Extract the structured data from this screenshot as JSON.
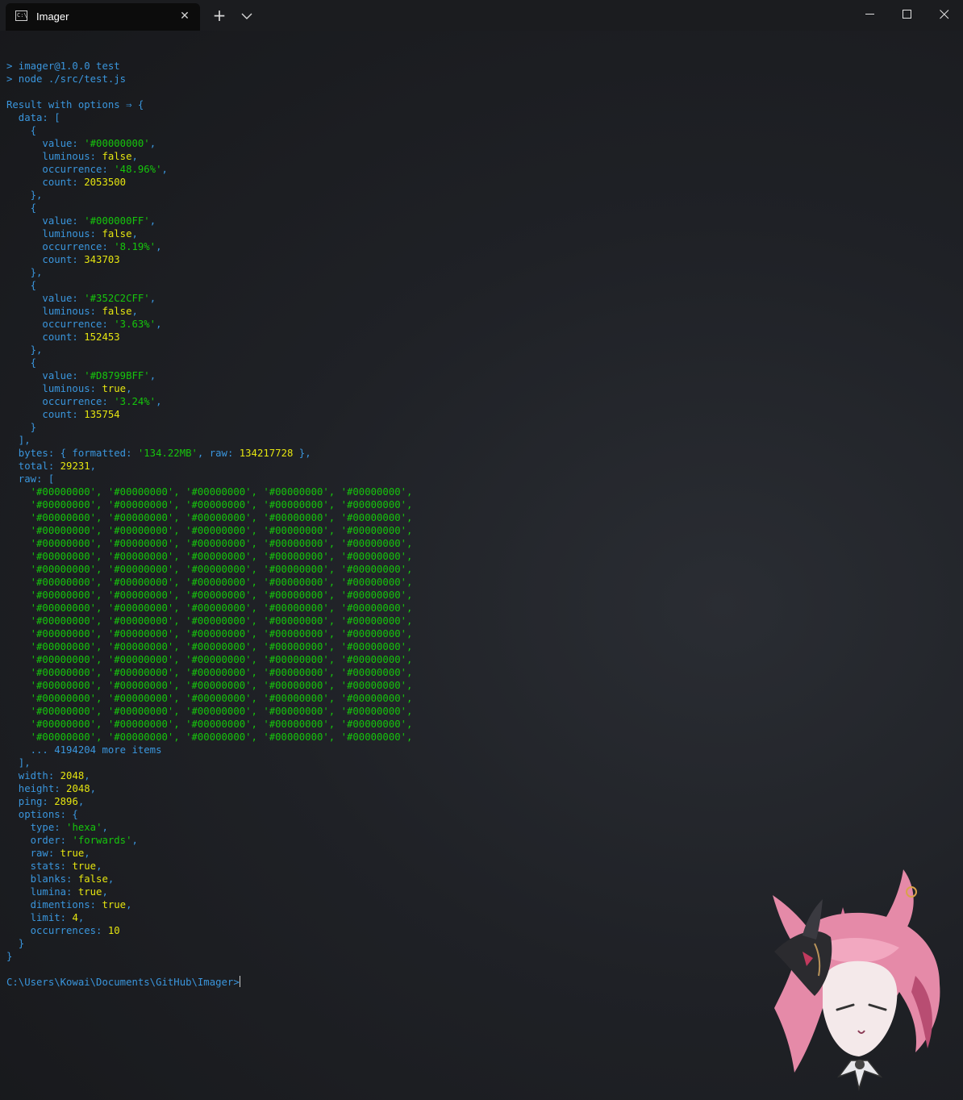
{
  "window": {
    "tab_title": "Imager",
    "tab_icon_text": "C:\\"
  },
  "terminal": {
    "lines": [
      [],
      [
        [
          "k",
          "> imager@1.0.0 test"
        ]
      ],
      [
        [
          "k",
          "> node ./src/test.js"
        ]
      ],
      [],
      [
        [
          "k",
          "Result with options ⇒ {"
        ]
      ],
      [
        [
          "k",
          "  data: ["
        ]
      ],
      [
        [
          "k",
          "    {"
        ]
      ],
      [
        [
          "k",
          "      value: "
        ],
        [
          "s",
          "'#00000000'"
        ],
        [
          "k",
          ","
        ]
      ],
      [
        [
          "k",
          "      luminous: "
        ],
        [
          "y",
          "false"
        ],
        [
          "k",
          ","
        ]
      ],
      [
        [
          "k",
          "      occurrence: "
        ],
        [
          "s",
          "'48.96%'"
        ],
        [
          "k",
          ","
        ]
      ],
      [
        [
          "k",
          "      count: "
        ],
        [
          "y",
          "2053500"
        ]
      ],
      [
        [
          "k",
          "    },"
        ]
      ],
      [
        [
          "k",
          "    {"
        ]
      ],
      [
        [
          "k",
          "      value: "
        ],
        [
          "s",
          "'#000000FF'"
        ],
        [
          "k",
          ","
        ]
      ],
      [
        [
          "k",
          "      luminous: "
        ],
        [
          "y",
          "false"
        ],
        [
          "k",
          ","
        ]
      ],
      [
        [
          "k",
          "      occurrence: "
        ],
        [
          "s",
          "'8.19%'"
        ],
        [
          "k",
          ","
        ]
      ],
      [
        [
          "k",
          "      count: "
        ],
        [
          "y",
          "343703"
        ]
      ],
      [
        [
          "k",
          "    },"
        ]
      ],
      [
        [
          "k",
          "    {"
        ]
      ],
      [
        [
          "k",
          "      value: "
        ],
        [
          "s",
          "'#352C2CFF'"
        ],
        [
          "k",
          ","
        ]
      ],
      [
        [
          "k",
          "      luminous: "
        ],
        [
          "y",
          "false"
        ],
        [
          "k",
          ","
        ]
      ],
      [
        [
          "k",
          "      occurrence: "
        ],
        [
          "s",
          "'3.63%'"
        ],
        [
          "k",
          ","
        ]
      ],
      [
        [
          "k",
          "      count: "
        ],
        [
          "y",
          "152453"
        ]
      ],
      [
        [
          "k",
          "    },"
        ]
      ],
      [
        [
          "k",
          "    {"
        ]
      ],
      [
        [
          "k",
          "      value: "
        ],
        [
          "s",
          "'#D8799BFF'"
        ],
        [
          "k",
          ","
        ]
      ],
      [
        [
          "k",
          "      luminous: "
        ],
        [
          "y",
          "true"
        ],
        [
          "k",
          ","
        ]
      ],
      [
        [
          "k",
          "      occurrence: "
        ],
        [
          "s",
          "'3.24%'"
        ],
        [
          "k",
          ","
        ]
      ],
      [
        [
          "k",
          "      count: "
        ],
        [
          "y",
          "135754"
        ]
      ],
      [
        [
          "k",
          "    }"
        ]
      ],
      [
        [
          "k",
          "  ],"
        ]
      ],
      [
        [
          "k",
          "  bytes: { formatted: "
        ],
        [
          "s",
          "'134.22MB'"
        ],
        [
          "k",
          ", raw: "
        ],
        [
          "y",
          "134217728"
        ],
        [
          "k",
          " },"
        ]
      ],
      [
        [
          "k",
          "  total: "
        ],
        [
          "y",
          "29231"
        ],
        [
          "k",
          ","
        ]
      ],
      [
        [
          "k",
          "  raw: ["
        ]
      ],
      [
        [
          "s",
          "    '#00000000', '#00000000', '#00000000', '#00000000', '#00000000',"
        ]
      ],
      [
        [
          "s",
          "    '#00000000', '#00000000', '#00000000', '#00000000', '#00000000',"
        ]
      ],
      [
        [
          "s",
          "    '#00000000', '#00000000', '#00000000', '#00000000', '#00000000',"
        ]
      ],
      [
        [
          "s",
          "    '#00000000', '#00000000', '#00000000', '#00000000', '#00000000',"
        ]
      ],
      [
        [
          "s",
          "    '#00000000', '#00000000', '#00000000', '#00000000', '#00000000',"
        ]
      ],
      [
        [
          "s",
          "    '#00000000', '#00000000', '#00000000', '#00000000', '#00000000',"
        ]
      ],
      [
        [
          "s",
          "    '#00000000', '#00000000', '#00000000', '#00000000', '#00000000',"
        ]
      ],
      [
        [
          "s",
          "    '#00000000', '#00000000', '#00000000', '#00000000', '#00000000',"
        ]
      ],
      [
        [
          "s",
          "    '#00000000', '#00000000', '#00000000', '#00000000', '#00000000',"
        ]
      ],
      [
        [
          "s",
          "    '#00000000', '#00000000', '#00000000', '#00000000', '#00000000',"
        ]
      ],
      [
        [
          "s",
          "    '#00000000', '#00000000', '#00000000', '#00000000', '#00000000',"
        ]
      ],
      [
        [
          "s",
          "    '#00000000', '#00000000', '#00000000', '#00000000', '#00000000',"
        ]
      ],
      [
        [
          "s",
          "    '#00000000', '#00000000', '#00000000', '#00000000', '#00000000',"
        ]
      ],
      [
        [
          "s",
          "    '#00000000', '#00000000', '#00000000', '#00000000', '#00000000',"
        ]
      ],
      [
        [
          "s",
          "    '#00000000', '#00000000', '#00000000', '#00000000', '#00000000',"
        ]
      ],
      [
        [
          "s",
          "    '#00000000', '#00000000', '#00000000', '#00000000', '#00000000',"
        ]
      ],
      [
        [
          "s",
          "    '#00000000', '#00000000', '#00000000', '#00000000', '#00000000',"
        ]
      ],
      [
        [
          "s",
          "    '#00000000', '#00000000', '#00000000', '#00000000', '#00000000',"
        ]
      ],
      [
        [
          "s",
          "    '#00000000', '#00000000', '#00000000', '#00000000', '#00000000',"
        ]
      ],
      [
        [
          "s",
          "    '#00000000', '#00000000', '#00000000', '#00000000', '#00000000',"
        ]
      ],
      [
        [
          "k",
          "    ... 4194204 more items"
        ]
      ],
      [
        [
          "k",
          "  ],"
        ]
      ],
      [
        [
          "k",
          "  width: "
        ],
        [
          "y",
          "2048"
        ],
        [
          "k",
          ","
        ]
      ],
      [
        [
          "k",
          "  height: "
        ],
        [
          "y",
          "2048"
        ],
        [
          "k",
          ","
        ]
      ],
      [
        [
          "k",
          "  ping: "
        ],
        [
          "y",
          "2896"
        ],
        [
          "k",
          ","
        ]
      ],
      [
        [
          "k",
          "  options: {"
        ]
      ],
      [
        [
          "k",
          "    type: "
        ],
        [
          "s",
          "'hexa'"
        ],
        [
          "k",
          ","
        ]
      ],
      [
        [
          "k",
          "    order: "
        ],
        [
          "s",
          "'forwards'"
        ],
        [
          "k",
          ","
        ]
      ],
      [
        [
          "k",
          "    raw: "
        ],
        [
          "y",
          "true"
        ],
        [
          "k",
          ","
        ]
      ],
      [
        [
          "k",
          "    stats: "
        ],
        [
          "y",
          "true"
        ],
        [
          "k",
          ","
        ]
      ],
      [
        [
          "k",
          "    blanks: "
        ],
        [
          "y",
          "false"
        ],
        [
          "k",
          ","
        ]
      ],
      [
        [
          "k",
          "    lumina: "
        ],
        [
          "y",
          "true"
        ],
        [
          "k",
          ","
        ]
      ],
      [
        [
          "k",
          "    dimentions: "
        ],
        [
          "y",
          "true"
        ],
        [
          "k",
          ","
        ]
      ],
      [
        [
          "k",
          "    limit: "
        ],
        [
          "y",
          "4"
        ],
        [
          "k",
          ","
        ]
      ],
      [
        [
          "k",
          "    occurrences: "
        ],
        [
          "y",
          "10"
        ]
      ],
      [
        [
          "k",
          "  }"
        ]
      ],
      [
        [
          "k",
          "}"
        ]
      ],
      []
    ],
    "prompt": "C:\\Users\\Kowai\\Documents\\GitHub\\Imager>"
  },
  "colors": {
    "keys": "#3a96dd",
    "strings": "#16c60c",
    "literals": "#e5e510",
    "mascot_hair": "#e58aa8",
    "mascot_horns": "#2b2b2f"
  },
  "icons": {
    "tab_icon": "terminal-icon",
    "tab_close": "close-icon",
    "new_tab": "plus-icon",
    "dropdown": "chevron-down-icon",
    "minimize": "minimize-icon",
    "maximize": "maximize-icon",
    "close": "close-icon"
  }
}
